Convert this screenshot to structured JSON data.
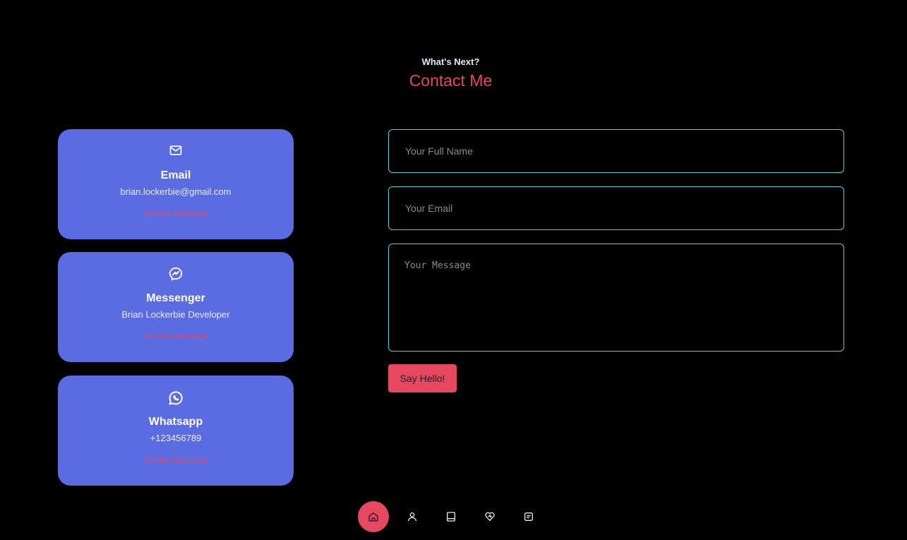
{
  "header": {
    "subtitle": "What's Next?",
    "title": "Contact Me"
  },
  "contact_cards": [
    {
      "icon": "mail-icon",
      "title": "Email",
      "value": "brian.lockerbie@gmail.com",
      "link": "Send a message"
    },
    {
      "icon": "messenger-icon",
      "title": "Messenger",
      "value": "Brian Lockerbie Developer",
      "link": "Send a message"
    },
    {
      "icon": "whatsapp-icon",
      "title": "Whatsapp",
      "value": "+123456789",
      "link": "Send a message"
    }
  ],
  "form": {
    "name_placeholder": "Your Full Name",
    "email_placeholder": "Your Email",
    "message_placeholder": "Your Message",
    "submit_label": "Say Hello!"
  },
  "nav": {
    "items": [
      "home-icon",
      "user-icon",
      "book-icon",
      "services-icon",
      "message-icon"
    ],
    "active": "home-icon"
  },
  "colors": {
    "background": "#000000",
    "accent": "#e5485f",
    "card": "#5b6ce2",
    "field_border": "#4fd1d9"
  }
}
